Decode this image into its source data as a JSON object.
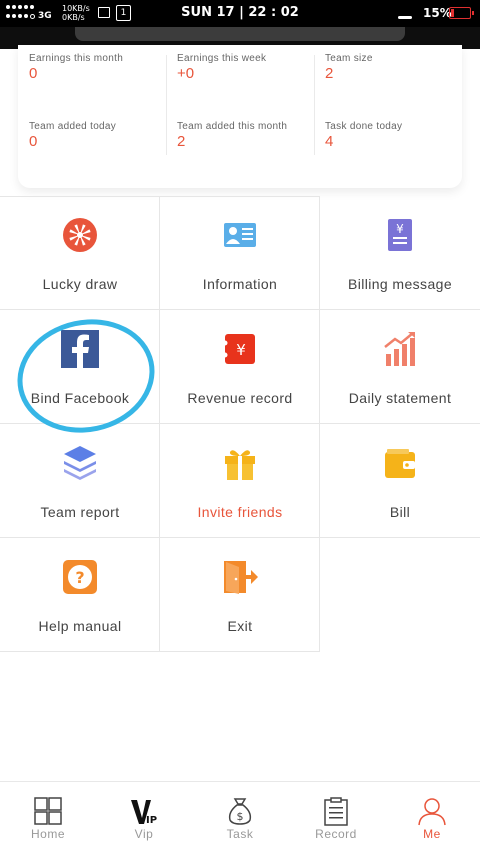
{
  "status_bar": {
    "network": "3G",
    "speed_up": "10KB/s",
    "speed_down": "0KB/s",
    "sim": "1",
    "clock": "SUN 17 | 22 : 02",
    "battery": "15%"
  },
  "stats": [
    {
      "label": "Earnings this month",
      "value": "0"
    },
    {
      "label": "Earnings this week",
      "value": "+0"
    },
    {
      "label": "Team size",
      "value": "2"
    },
    {
      "label": "Team added today",
      "value": "0"
    },
    {
      "label": "Team added this month",
      "value": "2"
    },
    {
      "label": "Task done today",
      "value": "4"
    }
  ],
  "menu": [
    {
      "label": "Lucky draw",
      "icon": "wheel-icon"
    },
    {
      "label": "Information",
      "icon": "id-card-icon"
    },
    {
      "label": "Billing message",
      "icon": "yen-document-icon"
    },
    {
      "label": "Bind Facebook",
      "icon": "facebook-icon"
    },
    {
      "label": "Revenue record",
      "icon": "yen-ticket-icon"
    },
    {
      "label": "Daily statement",
      "icon": "bar-chart-icon"
    },
    {
      "label": "Team report",
      "icon": "layers-icon"
    },
    {
      "label": "Invite friends",
      "icon": "gift-icon"
    },
    {
      "label": "Bill",
      "icon": "wallet-icon"
    },
    {
      "label": "Help manual",
      "icon": "question-icon"
    },
    {
      "label": "Exit",
      "icon": "exit-door-icon"
    }
  ],
  "bottom_nav": [
    {
      "label": "Home",
      "icon": "grid-icon"
    },
    {
      "label": "Vip",
      "icon": "vip-icon"
    },
    {
      "label": "Task",
      "icon": "money-bag-icon"
    },
    {
      "label": "Record",
      "icon": "clipboard-icon"
    },
    {
      "label": "Me",
      "icon": "person-icon",
      "active": true
    }
  ],
  "colors": {
    "accent": "#e8553b",
    "highlight_circle": "#36b6e6",
    "facebook": "#3b5998"
  }
}
